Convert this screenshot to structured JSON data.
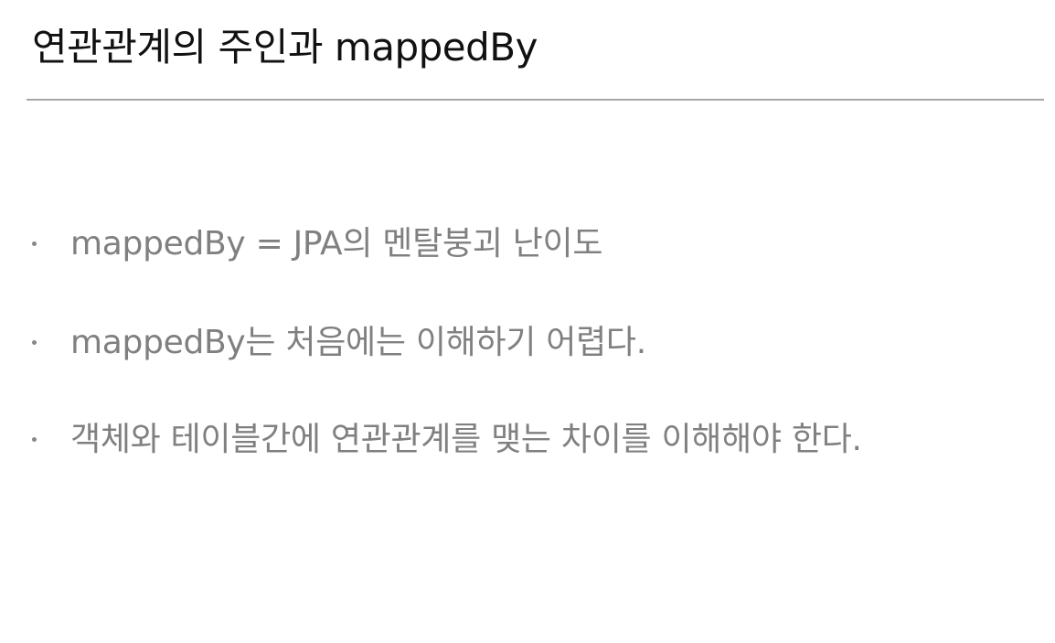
{
  "slide": {
    "title": "연관관계의 주인과 mappedBy",
    "bullets": [
      {
        "text": "mappedBy = JPA의 멘탈붕괴 난이도"
      },
      {
        "text": "mappedBy는 처음에는 이해하기 어렵다."
      },
      {
        "text": "객체와 테이블간에 연관관계를 맺는 차이를 이해해야 한다."
      }
    ]
  },
  "colors": {
    "title": "#111111",
    "bullet_text": "#808080",
    "divider": "#a6a6a6",
    "background": "#ffffff"
  }
}
